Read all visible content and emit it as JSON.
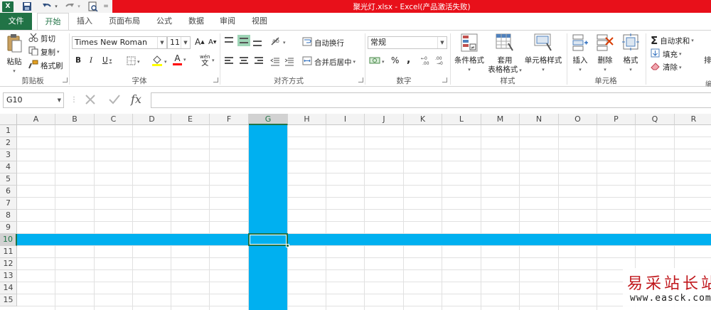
{
  "window": {
    "title": "聚光灯.xlsx - Excel(产品激活失败)",
    "app_icon": "excel-logo",
    "app_letter": "X",
    "accent": "#e8101a",
    "brand": "#217346"
  },
  "quick_access": [
    {
      "name": "save",
      "icon": "save-icon"
    },
    {
      "name": "undo",
      "icon": "undo-icon"
    },
    {
      "name": "redo",
      "icon": "redo-icon"
    },
    {
      "name": "print-preview",
      "icon": "print-preview-icon"
    },
    {
      "name": "customize",
      "icon": "customize-qat-icon"
    }
  ],
  "tabs": [
    "文件",
    "开始",
    "插入",
    "页面布局",
    "公式",
    "数据",
    "审阅",
    "视图"
  ],
  "active_tab": "开始",
  "ribbon": {
    "clipboard": {
      "label": "剪贴板",
      "paste": "粘贴",
      "cut": "剪切",
      "copy": "复制",
      "format_painter": "格式刷"
    },
    "font": {
      "label": "字体",
      "font_name": "Times New Roman",
      "font_size": "11",
      "grow": "A",
      "shrink": "A",
      "bold": "B",
      "italic": "I",
      "underline": "U",
      "font_color_letter": "A",
      "phonetic_top": "wén",
      "phonetic_bottom": "文",
      "font_color": "#ff0000",
      "fill_color": "#ffff00"
    },
    "alignment": {
      "label": "对齐方式",
      "wrap_text": "自动换行",
      "merge_center": "合并后居中"
    },
    "number": {
      "label": "数字",
      "format": "常规",
      "percent": "%",
      "comma": ","
    },
    "styles": {
      "label": "样式",
      "conditional": "条件格式",
      "format_table_1": "套用",
      "format_table_2": "表格格式",
      "cell_styles": "单元格样式"
    },
    "cells": {
      "label": "单元格",
      "insert": "插入",
      "delete": "删除",
      "format": "格式"
    },
    "editing": {
      "autosum": "自动求和",
      "fill": "填充",
      "clear": "清除",
      "sort_partial": "排"
    }
  },
  "formula_bar": {
    "name_box": "G10",
    "fx": "fx",
    "value": ""
  },
  "sheet": {
    "columns": [
      "A",
      "B",
      "C",
      "D",
      "E",
      "F",
      "G",
      "H",
      "I",
      "J",
      "K",
      "L",
      "M",
      "N",
      "O",
      "P",
      "Q",
      "R"
    ],
    "rows": [
      "1",
      "2",
      "3",
      "4",
      "5",
      "6",
      "7",
      "8",
      "9",
      "10",
      "11",
      "12",
      "13",
      "14",
      "15"
    ],
    "active_cell": "G10",
    "highlight_column": "G",
    "highlight_row": "10",
    "highlight_color": "#00b0f0"
  },
  "watermark": {
    "text": "易采站长站",
    "url": "www.easck.com",
    "color": "#c0171c"
  }
}
